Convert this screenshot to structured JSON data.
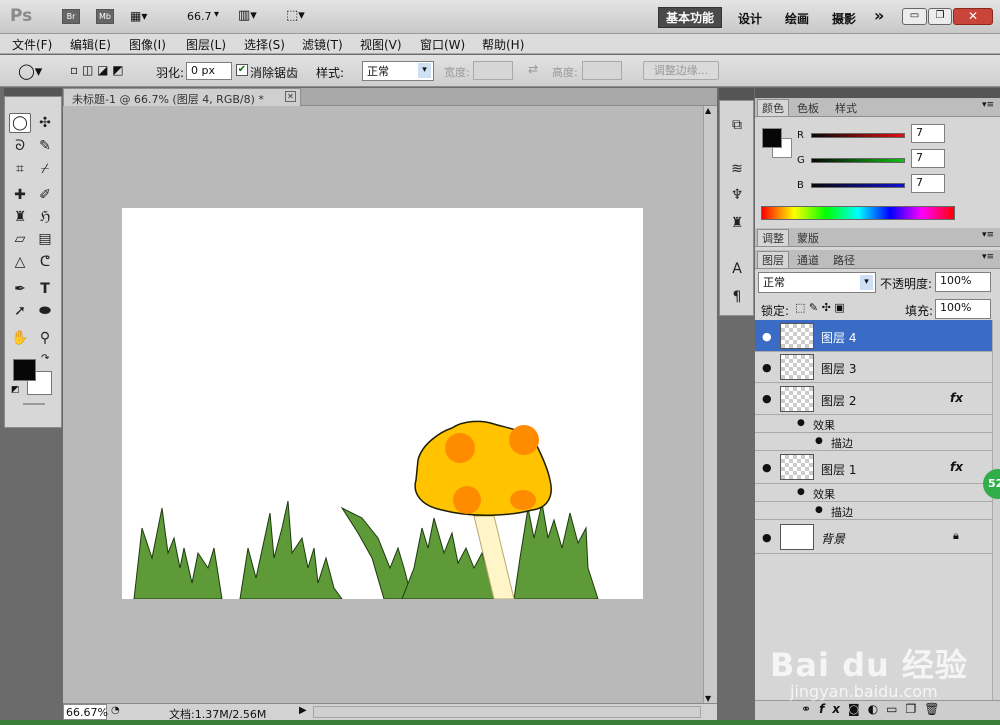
{
  "title_bar": {
    "app_logo": "Ps",
    "bridge": "Br",
    "mini_bridge": "Mb",
    "zoom": "66.7",
    "workspaces": [
      "基本功能",
      "设计",
      "绘画",
      "摄影"
    ],
    "more": "»"
  },
  "menu": [
    "文件(F)",
    "编辑(E)",
    "图像(I)",
    "图层(L)",
    "选择(S)",
    "滤镜(T)",
    "视图(V)",
    "窗口(W)",
    "帮助(H)"
  ],
  "options": {
    "feather_label": "羽化:",
    "feather_value": "0 px",
    "antialias_label": "消除锯齿",
    "style_label": "样式:",
    "style_value": "正常",
    "width_label": "宽度:",
    "height_label": "高度:",
    "refine_edge": "调整边缘..."
  },
  "document": {
    "tab_title": "未标题-1 @ 66.7% (图层 4, RGB/8) *",
    "zoom_status": "66.67%",
    "doc_size": "文档:1.37M/2.56M"
  },
  "color_panel": {
    "tabs": [
      "颜色",
      "色板",
      "样式"
    ],
    "channels": [
      {
        "label": "R",
        "value": "7",
        "color": "#e01010"
      },
      {
        "label": "G",
        "value": "7",
        "color": "#10c010"
      },
      {
        "label": "B",
        "value": "7",
        "color": "#1010d0"
      }
    ]
  },
  "adjust_panel": {
    "tabs": [
      "调整",
      "蒙版"
    ]
  },
  "layers_panel": {
    "tabs": [
      "图层",
      "通道",
      "路径"
    ],
    "blend_mode": "正常",
    "opacity_label": "不透明度:",
    "opacity_value": "100%",
    "lock_label": "锁定:",
    "fill_label": "填充:",
    "fill_value": "100%",
    "layers": [
      {
        "name": "图层 4",
        "selected": true,
        "fx": false
      },
      {
        "name": "图层 3",
        "selected": false,
        "fx": false
      },
      {
        "name": "图层 2",
        "selected": false,
        "fx": true,
        "effects_label": "效果",
        "stroke_label": "描边"
      },
      {
        "name": "图层 1",
        "selected": false,
        "fx": true,
        "effects_label": "效果",
        "stroke_label": "描边"
      },
      {
        "name": "背景",
        "selected": false,
        "fx": false,
        "locked": true
      }
    ],
    "fx_symbol": "fx"
  },
  "side_badge": "52",
  "watermark": {
    "brand": "Bai du 经验",
    "url": "jingyan.baidu.com"
  }
}
